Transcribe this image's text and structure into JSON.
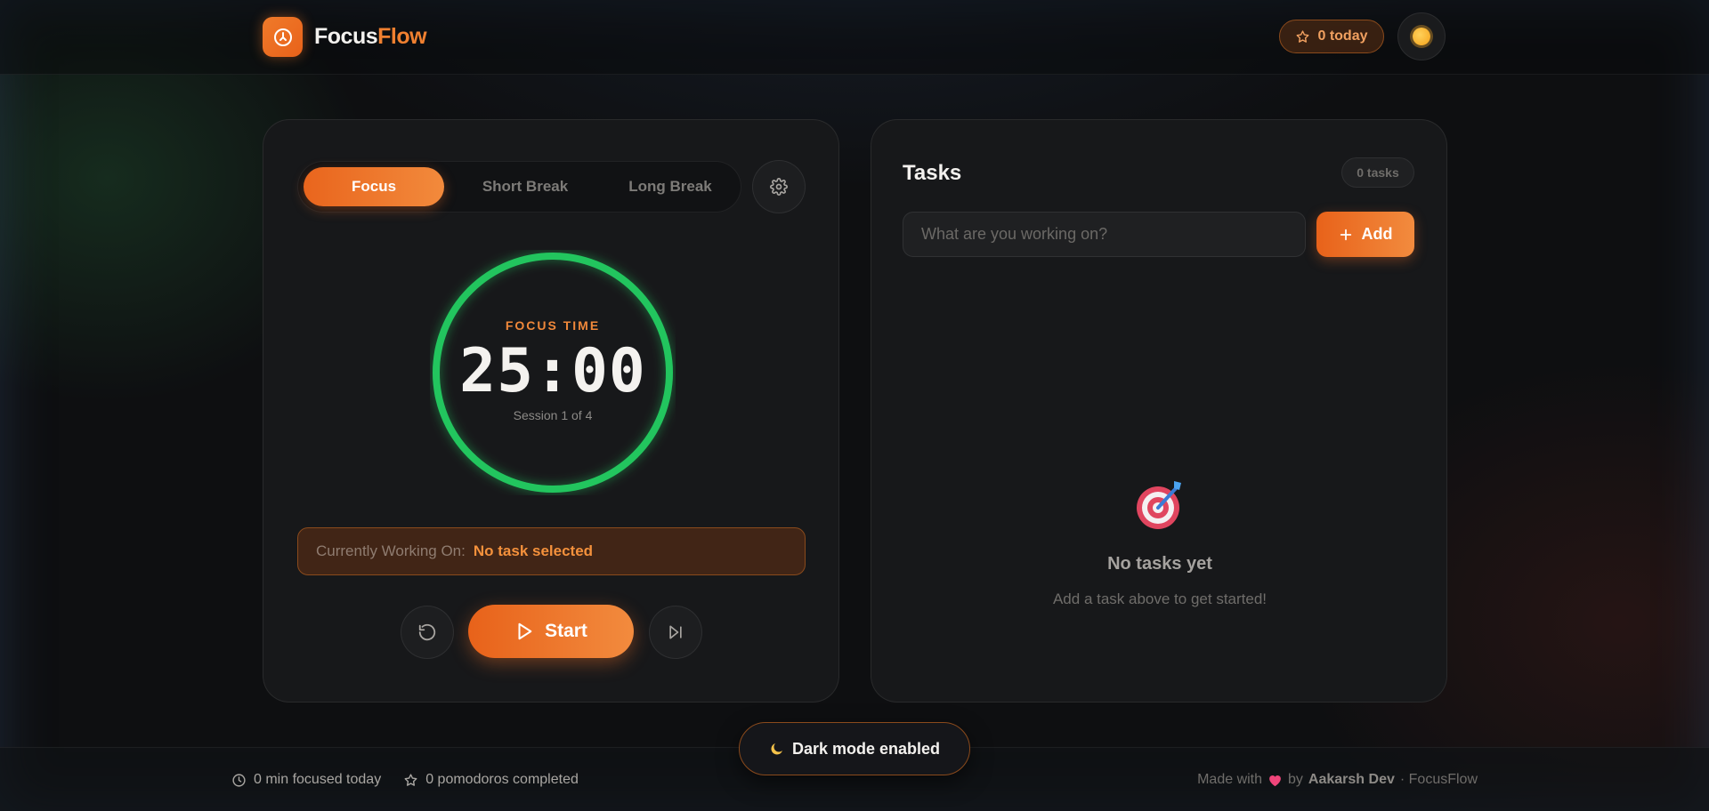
{
  "brand": {
    "name_part1": "Focus",
    "name_part2": "Flow"
  },
  "header": {
    "today_count": "0 today"
  },
  "timer": {
    "modes": [
      "Focus",
      "Short Break",
      "Long Break"
    ],
    "active_mode": "Focus",
    "label": "FOCUS TIME",
    "time": "25:00",
    "session": "Session 1 of 4",
    "working_on_label": "Currently Working On:",
    "working_on_value": "No task selected",
    "start_label": "Start",
    "ring_progress": 1.0
  },
  "tasks": {
    "title": "Tasks",
    "count": "0 tasks",
    "input_placeholder": "What are you working on?",
    "add_label": "Add",
    "empty_title": "No tasks yet",
    "empty_subtitle": "Add a task above to get started!"
  },
  "footer": {
    "minutes_focused": "0 min focused today",
    "pomodoros": "0 pomodoros completed",
    "made_with": "Made with",
    "by": "by",
    "author": "Aakarsh Dev",
    "suffix": "· FocusFlow"
  },
  "toast": {
    "text": "Dark mode enabled"
  },
  "colors": {
    "accent": "#f08030",
    "ring": "#22c55e",
    "background": "#0e0f11",
    "card": "#17181a"
  }
}
